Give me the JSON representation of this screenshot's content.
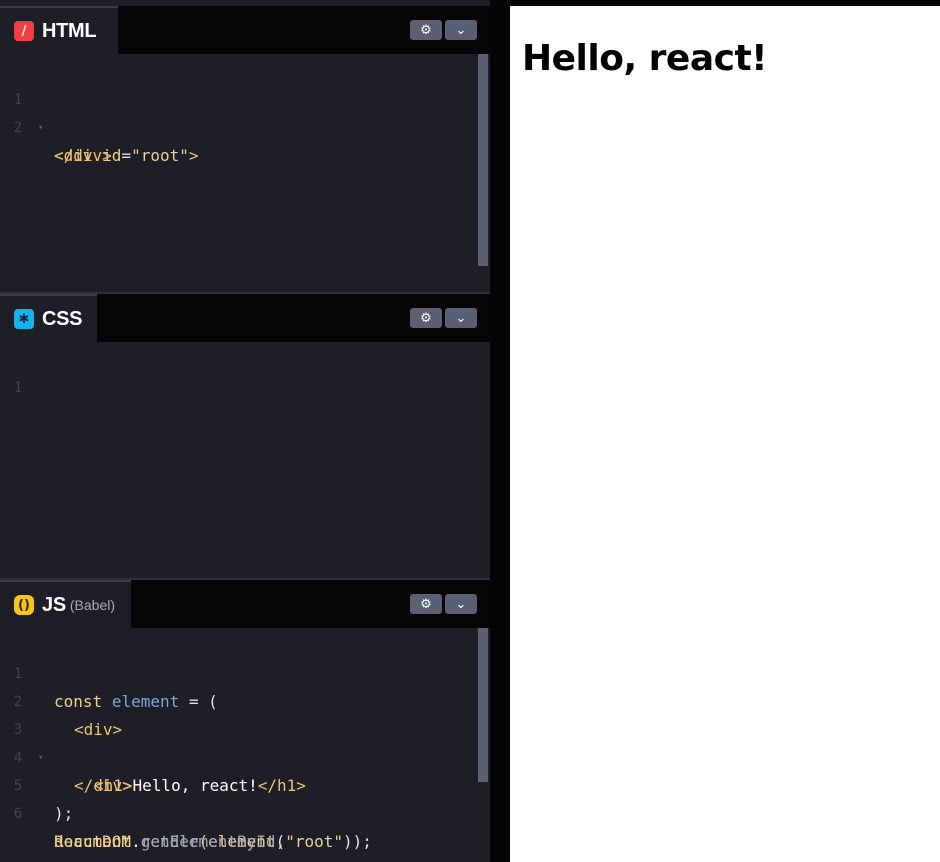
{
  "panels": {
    "html": {
      "title": "HTML",
      "badge": "/",
      "lines": [
        {
          "n": "1",
          "fold": "▾"
        },
        {
          "n": "2",
          "fold": ""
        }
      ]
    },
    "css": {
      "title": "CSS",
      "badge": "✱",
      "lines": [
        {
          "n": "1",
          "fold": ""
        }
      ]
    },
    "js": {
      "title": "JS",
      "subtitle": "(Babel)",
      "badge": "()",
      "lines": [
        {
          "n": "1",
          "fold": ""
        },
        {
          "n": "2",
          "fold": ""
        },
        {
          "n": "3",
          "fold": "▾"
        },
        {
          "n": "4",
          "fold": ""
        },
        {
          "n": "5",
          "fold": ""
        },
        {
          "n": "6",
          "fold": ""
        }
      ]
    }
  },
  "code": {
    "html1": {
      "open": "<div",
      "attr": "id",
      "eq": "=",
      "str": "\"root\"",
      "close": ">"
    },
    "html2": {
      "tag": "</div>"
    },
    "js1": {
      "kw": "const",
      "var": "element",
      "rest": " = ("
    },
    "js2": {
      "tag": "<div>"
    },
    "js3": {
      "open": "<h1>",
      "text": "Hello, react!",
      "close": "</h1>"
    },
    "js4": {
      "tag": "</div>"
    },
    "js5": {
      "text": ");"
    },
    "js6": {
      "obj": "ReactDOM",
      "dot": ".",
      "fn": "render",
      "args": "(element,"
    },
    "js7": {
      "obj": "document",
      "dot": ".",
      "fn": "getElementById",
      "open": "(",
      "str": "\"root\"",
      "close": "));"
    }
  },
  "controls": {
    "gear": "gear-icon",
    "chevron": "chevron-down-icon"
  },
  "preview": {
    "heading": "Hello, react!"
  },
  "colors": {
    "html_badge": "#ef3e44",
    "css_badge": "#15b2ef",
    "js_badge": "#f7c515",
    "editor_bg": "#1e1f26"
  }
}
